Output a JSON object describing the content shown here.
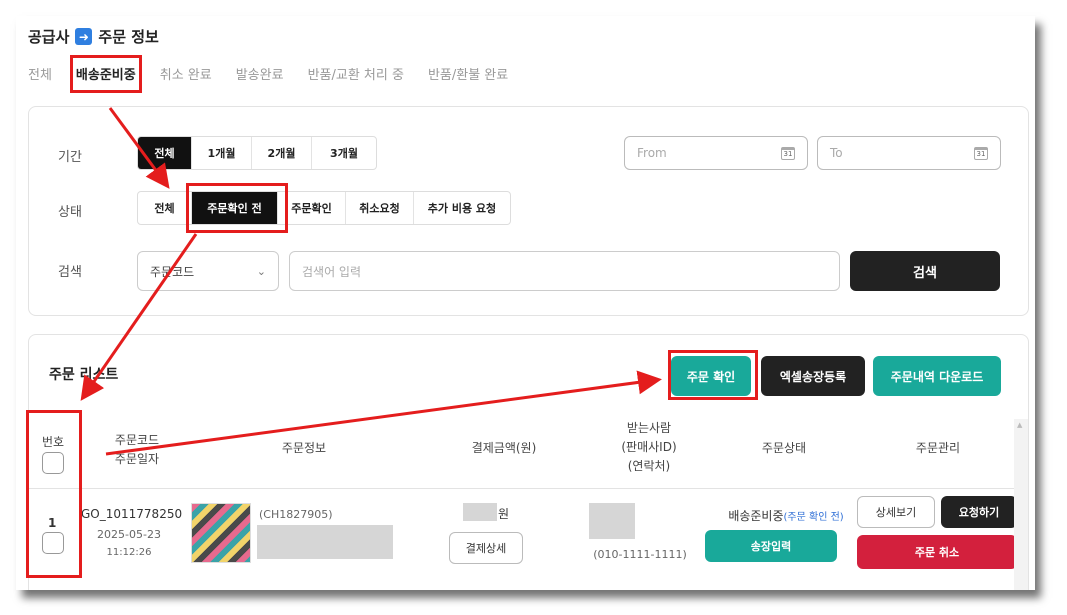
{
  "breadcrumb": {
    "root": "공급사",
    "page": "주문 정보"
  },
  "tabs": [
    {
      "label": "전체",
      "active": false
    },
    {
      "label": "배송준비중",
      "active": true
    },
    {
      "label": "취소 완료",
      "active": false
    },
    {
      "label": "발송완료",
      "active": false
    },
    {
      "label": "반품/교환 처리 중",
      "active": false
    },
    {
      "label": "반품/환불 완료",
      "active": false
    }
  ],
  "filters": {
    "period_label": "기간",
    "period_options": [
      "전체",
      "1개월",
      "2개월",
      "3개월"
    ],
    "period_selected": "전체",
    "from_placeholder": "From",
    "to_placeholder": "To",
    "status_label": "상태",
    "status_options": [
      "전체",
      "주문확인 전",
      "주문확인",
      "취소요청",
      "추가 비용 요청"
    ],
    "status_selected": "주문확인 전",
    "search_label": "검색",
    "search_select_value": "주문코드",
    "search_placeholder": "검색어 입력",
    "search_button": "검색"
  },
  "list": {
    "title": "주문 리스트",
    "buttons": {
      "confirm": "주문 확인",
      "excel": "엑셀송장등록",
      "download": "주문내역 다운로드"
    },
    "headers": {
      "no": "번호",
      "code_line1": "주문코드",
      "code_line2": "주문일자",
      "info": "주문정보",
      "amount": "결제금액(원)",
      "receiver_line1": "받는사람",
      "receiver_line2": "(판매사ID)",
      "receiver_line3": "(연락처)",
      "status": "주문상태",
      "manage": "주문관리"
    },
    "rows": [
      {
        "no": "1",
        "order_code": "GO_1011778250",
        "date": "2025-05-23",
        "time": "11:12:26",
        "product_code": "(CH1827905)",
        "amount_unit": "원",
        "payment_detail": "결제상세",
        "phone": "(010-1111-1111)",
        "status": "배송준비중",
        "status_sub": "(주문 확인 전)",
        "invoice_button": "송장입력",
        "detail_button": "상세보기",
        "request_button": "요청하기",
        "cancel_button": "주문 취소"
      }
    ]
  },
  "colors": {
    "accent_teal": "#19a99a",
    "dark": "#222222",
    "danger": "#d3203d",
    "annotation_red": "#e41d1d",
    "status_sub_blue": "#2f6fd6"
  }
}
